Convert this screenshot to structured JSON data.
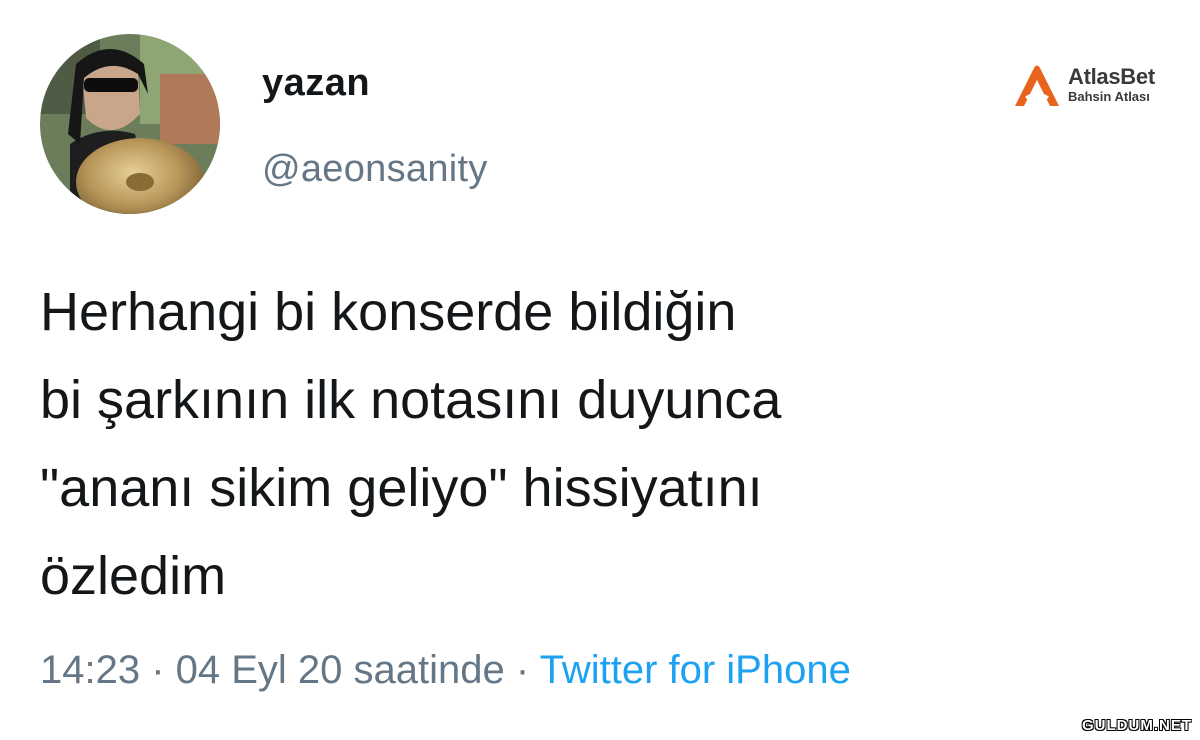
{
  "tweet": {
    "display_name": "yazan",
    "handle": "@aeonsanity",
    "text_lines": [
      "Herhangi bi konserde bildiğin",
      "bi şarkının ilk notasını duyunca",
      "\"ananı sikim geliyo\" hissiyatını",
      "özledim"
    ],
    "timestamp": "14:23 · 04 Eyl 20 saatinde · ",
    "source": "Twitter for iPhone",
    "avatar_icon": "profile-photo-avatar"
  },
  "overlay": {
    "brand_logo_name": "AtlasBet",
    "brand_logo_tagline": "Bahsin Atlası",
    "watermark": "GULDUM.NET"
  },
  "colors": {
    "text_primary": "#14171a",
    "text_secondary": "#657786",
    "link": "#1da1f2",
    "brand_orange": "#e8641e"
  }
}
